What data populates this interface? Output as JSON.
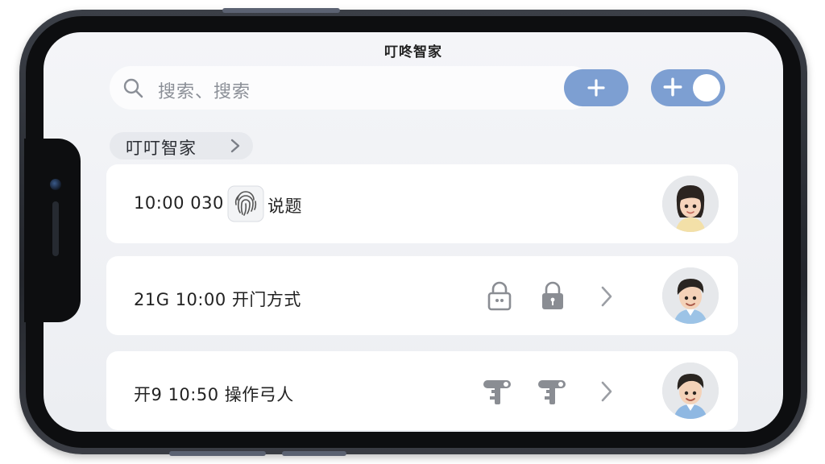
{
  "app": {
    "title": "叮咚智家"
  },
  "search": {
    "placeholder": "搜索、搜索"
  },
  "toolbar": {
    "add_icon": "plus-icon",
    "toggle_icon": "plus-toggle-icon"
  },
  "section": {
    "label": "叮叮智家"
  },
  "records": [
    {
      "time": "10:00",
      "code": "030",
      "label": "说题",
      "icon": "fingerprint-icon"
    },
    {
      "prefix": "21G",
      "time": "10:00",
      "label": "开门方式",
      "icons": [
        "lock-icon",
        "lock-icon"
      ]
    },
    {
      "prefix": "开9",
      "time": "10:50",
      "label": "操作弓人",
      "icons": [
        "key-icon",
        "key-icon"
      ]
    }
  ],
  "colors": {
    "accent": "#7d9fd2",
    "background": "#f0f1f4",
    "card": "#ffffff"
  }
}
